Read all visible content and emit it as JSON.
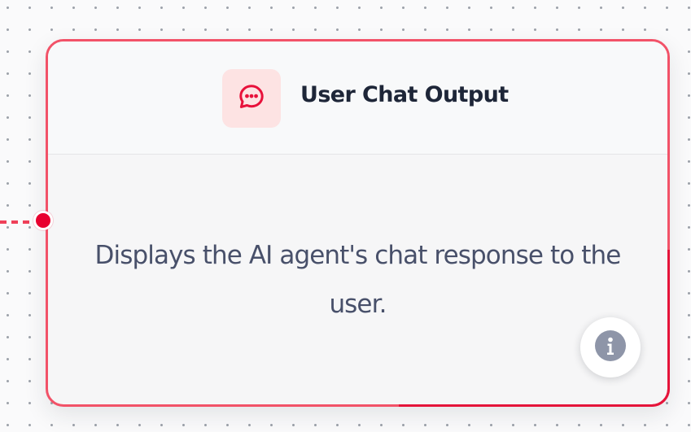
{
  "node": {
    "title": "User Chat Output",
    "description": "Displays the AI agent's chat response to the user.",
    "icon": "chat-bubble-icon",
    "info_icon": "info-icon",
    "colors": {
      "accent": "#e8002f",
      "border": "#f25268",
      "icon_tile_bg": "#fde3e3",
      "title": "#1e2638",
      "description": "#48506a"
    }
  }
}
